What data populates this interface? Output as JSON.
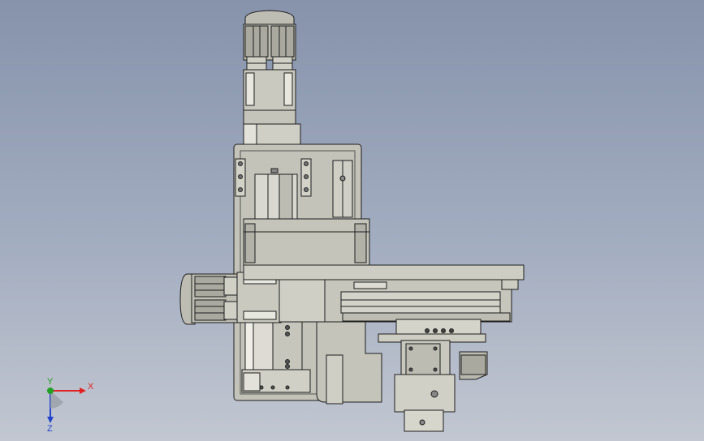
{
  "view": {
    "type": "cad-3d-viewport",
    "background_top": "#8693ab",
    "background_bottom": "#c2c7d1",
    "part_color": "#c9c9bf",
    "edge_color": "#1e1e1e"
  },
  "triad": {
    "x_label": "X",
    "y_label": "Y",
    "z_label": "Z",
    "x_color": "#e22222",
    "y_color": "#22a022",
    "z_color": "#2244cc"
  }
}
